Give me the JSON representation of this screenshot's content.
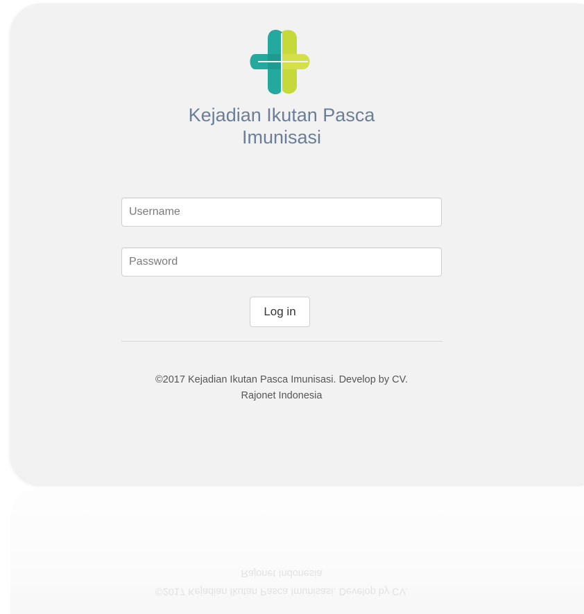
{
  "app": {
    "title_line1": "Kejadian Ikutan Pasca",
    "title_line2": "Imunisasi",
    "logo_icon": "kemenkes-logo-icon"
  },
  "form": {
    "username": {
      "placeholder": "Username",
      "value": ""
    },
    "password": {
      "placeholder": "Password",
      "value": ""
    },
    "login_label": "Log in"
  },
  "footer": {
    "line1": "©2017 Kejadian Ikutan Pasca Imunisasi. Develop by CV.",
    "line2": "Rajonet Indonesia"
  },
  "colors": {
    "title": "#6b7e98",
    "logo_teal": "#23a99e",
    "logo_lime": "#c6d93a",
    "card_bg": "#f2f2f3"
  }
}
